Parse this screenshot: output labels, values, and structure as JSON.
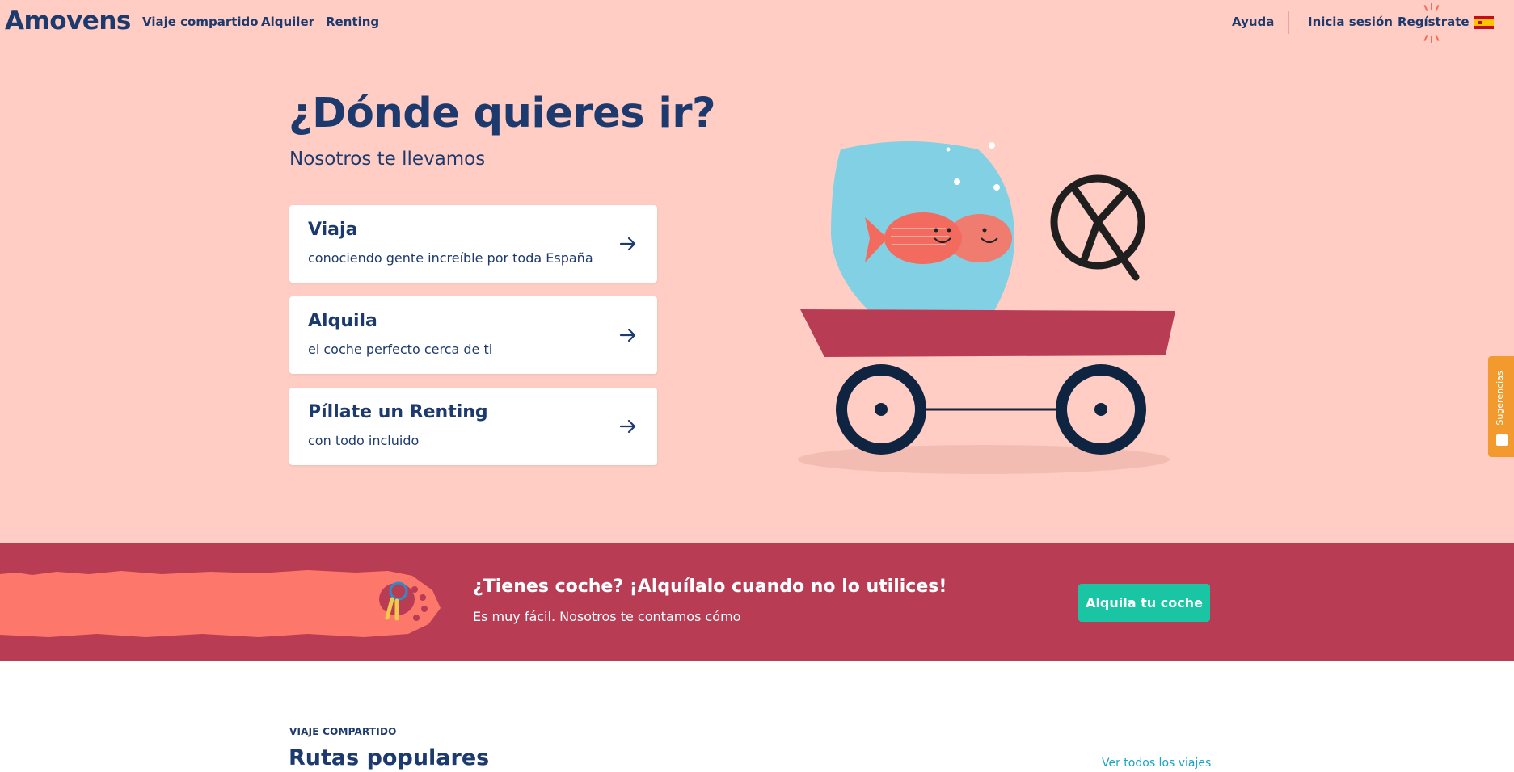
{
  "nav": {
    "logo": "Amovens",
    "links": [
      "Viaje compartido",
      "Alquiler",
      "Renting"
    ],
    "help": "Ayuda",
    "login": "Inicia sesión",
    "register": "Regístrate",
    "language_flag_icon": "spain-flag-icon"
  },
  "hero": {
    "title": "¿Dónde quieres ir?",
    "subtitle": "Nosotros te llevamos",
    "cards": [
      {
        "title": "Viaja",
        "desc": "conociendo gente increíble por toda España"
      },
      {
        "title": "Alquila",
        "desc": "el coche perfecto cerca de ti"
      },
      {
        "title": "Píllate un Renting",
        "desc": "con todo incluido"
      }
    ]
  },
  "banner": {
    "title": "¿Tienes coche? ¡Alquílalo cuando no lo utilices!",
    "subtitle": "Es muy fácil. Nosotros te contamos cómo",
    "button": "Alquila tu coche"
  },
  "feedback_tab": "Sugerencias",
  "section": {
    "eyebrow": "VIAJE COMPARTIDO",
    "title": "Rutas populares",
    "see_all": "Ver todos los viajes"
  },
  "colors": {
    "hero_bg": "#ffcdc3",
    "navy": "#1d3a6e",
    "banner_bg": "#b83d54",
    "accent_green": "#19c5a3",
    "feedback_orange": "#f29a2e"
  }
}
